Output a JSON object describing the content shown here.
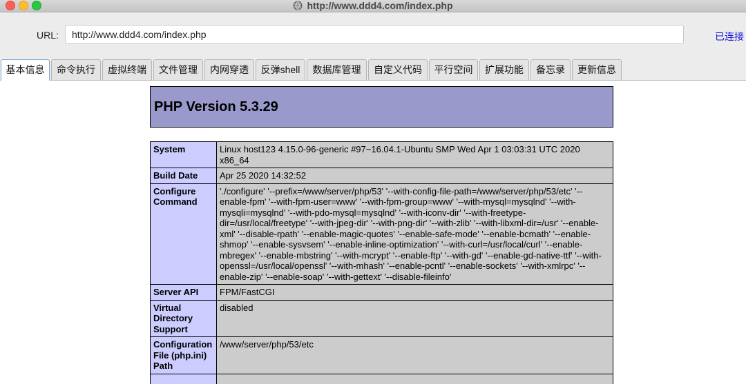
{
  "window": {
    "title": "http://www.ddd4.com/index.php"
  },
  "urlbar": {
    "label": "URL:",
    "value": "http://www.ddd4.com/index.php",
    "connect": "已连接"
  },
  "tabs": [
    {
      "label": "基本信息"
    },
    {
      "label": "命令执行"
    },
    {
      "label": "虚拟终端"
    },
    {
      "label": "文件管理"
    },
    {
      "label": "内网穿透"
    },
    {
      "label": "反弹shell"
    },
    {
      "label": "数据库管理"
    },
    {
      "label": "自定义代码"
    },
    {
      "label": "平行空间"
    },
    {
      "label": "扩展功能"
    },
    {
      "label": "备忘录"
    },
    {
      "label": "更新信息"
    }
  ],
  "active_tab": "基本信息",
  "phpinfo": {
    "title": "PHP Version 5.3.29",
    "rows": [
      {
        "key": "System",
        "value": "Linux host123 4.15.0-96-generic #97~16.04.1-Ubuntu SMP Wed Apr 1 03:03:31 UTC 2020 x86_64"
      },
      {
        "key": "Build Date",
        "value": "Apr 25 2020 14:32:52"
      },
      {
        "key": "Configure Command",
        "value": "'./configure' '--prefix=/www/server/php/53' '--with-config-file-path=/www/server/php/53/etc' '--enable-fpm' '--with-fpm-user=www' '--with-fpm-group=www' '--with-mysql=mysqlnd' '--with-mysqli=mysqlnd' '--with-pdo-mysql=mysqlnd' '--with-iconv-dir' '--with-freetype-dir=/usr/local/freetype' '--with-jpeg-dir' '--with-png-dir' '--with-zlib' '--with-libxml-dir=/usr' '--enable-xml' '--disable-rpath' '--enable-magic-quotes' '--enable-safe-mode' '--enable-bcmath' '--enable-shmop' '--enable-sysvsem' '--enable-inline-optimization' '--with-curl=/usr/local/curl' '--enable-mbregex' '--enable-mbstring' '--with-mcrypt' '--enable-ftp' '--with-gd' '--enable-gd-native-ttf' '--with-openssl=/usr/local/openssl' '--with-mhash' '--enable-pcntl' '--enable-sockets' '--with-xmlrpc' '--enable-zip' '--enable-soap' '--with-gettext' '--disable-fileinfo'"
      },
      {
        "key": "Server API",
        "value": "FPM/FastCGI"
      },
      {
        "key": "Virtual Directory Support",
        "value": "disabled"
      },
      {
        "key": "Configuration File (php.ini) Path",
        "value": "/www/server/php/53/etc"
      },
      {
        "key": "",
        "value": ""
      }
    ]
  },
  "colors": {
    "php_header": "#9999cc",
    "key_cell": "#ccccff",
    "value_cell": "#cccccc",
    "link": "#1515d6"
  }
}
